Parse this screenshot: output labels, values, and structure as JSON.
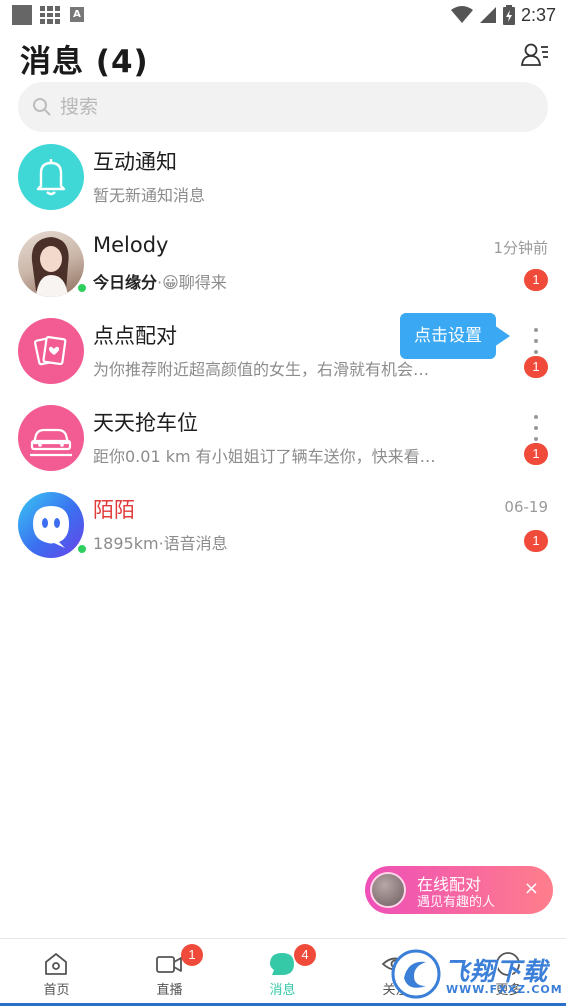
{
  "status_bar": {
    "time": "2:37"
  },
  "header": {
    "title": "消息 (4)"
  },
  "search": {
    "placeholder": "搜索"
  },
  "conversations": [
    {
      "name": "互动通知",
      "preview": "暂无新通知消息",
      "icon": "bell-icon",
      "color": "#3fd8d6"
    },
    {
      "name": "Melody",
      "preview_bold": "今日缘分",
      "preview_rest": "·😀聊得来",
      "time": "1分钟前",
      "badge": "1",
      "online": true
    },
    {
      "name": "点点配对",
      "preview": "为你推荐附近超高颜值的女生，右滑就有机会…",
      "badge": "1",
      "icon": "cards-icon",
      "color": "#f25c92"
    },
    {
      "name": "天天抢车位",
      "preview": "距你0.01 km 有小姐姐订了辆车送你，快来看…",
      "badge": "1",
      "icon": "car-icon",
      "color": "#f25c92"
    },
    {
      "name": "陌陌",
      "preview": "1895km·语音消息",
      "time": "06-19",
      "badge": "1",
      "online": true,
      "icon": "momo-logo-icon",
      "name_color": "#e23b3b"
    }
  ],
  "tooltip": {
    "text": "点击设置"
  },
  "match_pill": {
    "title": "在线配对",
    "subtitle": "遇见有趣的人",
    "close": "×"
  },
  "tabs": [
    {
      "label": "首页",
      "icon": "home-icon"
    },
    {
      "label": "直播",
      "icon": "video-icon",
      "badge": "1"
    },
    {
      "label": "消息",
      "icon": "chat-bubble-icon",
      "badge": "4",
      "active": true
    },
    {
      "label": "关注",
      "icon": "eye-icon"
    },
    {
      "label": "更多",
      "icon": "more-icon"
    }
  ],
  "watermark": {
    "text": "飞翔下载",
    "url": "WWW.FXXZ.COM"
  },
  "colors": {
    "accent": "#36c9a8",
    "badge": "#f04a3a",
    "tooltip": "#3aa8f2",
    "online": "#2fcf5f"
  }
}
